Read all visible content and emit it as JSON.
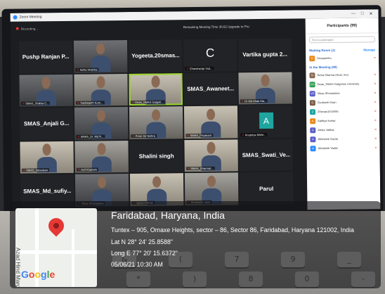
{
  "zoom": {
    "window_title": "Zoom Meeting",
    "recording_label": "Recording...",
    "banner": "Remaining Meeting Time 36:52 Upgrade to Pro",
    "window_controls": [
      "—",
      "□",
      "✕"
    ],
    "tiles": [
      {
        "kind": "name",
        "big": "Pushp Ranjan P...",
        "label": ""
      },
      {
        "kind": "cam",
        "big": "",
        "label": "Neha Sharma"
      },
      {
        "kind": "name",
        "big": "Yogeeta.20smas...",
        "label": ""
      },
      {
        "kind": "letter",
        "big": "C",
        "label": "Chandravija Yad..."
      },
      {
        "kind": "name",
        "big": "Vartika gupta 2...",
        "label": ""
      },
      {
        "kind": "cam",
        "big": "",
        "label": "SMAS_Shikha C..."
      },
      {
        "kind": "cam2",
        "big": "",
        "label": "Yashwanth Kum..."
      },
      {
        "kind": "cam3",
        "big": "",
        "label": "Dean_SMAS Galgoti...",
        "speaking": true
      },
      {
        "kind": "name",
        "big": "SMAS_Awaneet...",
        "label": ""
      },
      {
        "kind": "cam2",
        "big": "",
        "label": "Dr Md Aftab Ala..."
      },
      {
        "kind": "name",
        "big": "SMAS_Anjali G...",
        "label": ""
      },
      {
        "kind": "cam",
        "big": "",
        "label": "SMAS_Dr. Md N..."
      },
      {
        "kind": "cam2",
        "big": "",
        "label": "Prem Sri Nishra"
      },
      {
        "kind": "cam3",
        "big": "",
        "label": "SMAS_Priyakant"
      },
      {
        "kind": "avatar",
        "big": "A",
        "label": "Anupriya Mishr..."
      },
      {
        "kind": "cam3",
        "big": "",
        "label": "SMAS_Vatsalyan"
      },
      {
        "kind": "cam2",
        "big": "",
        "label": "Asif Khanam"
      },
      {
        "kind": "name",
        "big": "Shalini singh",
        "label": ""
      },
      {
        "kind": "cam3",
        "big": "",
        "label": "SMAS_Dharmat..."
      },
      {
        "kind": "name",
        "big": "SMAS_Swati_Ve...",
        "label": ""
      },
      {
        "kind": "name",
        "big": "SMAS_Md_sufiy...",
        "label": ""
      },
      {
        "kind": "cam",
        "big": "",
        "label": "Vikas Shrivastava"
      },
      {
        "kind": "cam3",
        "big": "",
        "label": "Ujjwal Pathak"
      },
      {
        "kind": "cam2",
        "big": "",
        "label": "Shashank Jana"
      },
      {
        "kind": "name",
        "big": "Parul",
        "label": ""
      }
    ],
    "participants": {
      "header": "Participants (99)",
      "search_placeholder": "Find a participant",
      "waiting_label": "Waiting Room (1)",
      "manage_label": "Manage",
      "waiting": [
        {
          "initial": "D",
          "name": "Deepanshu",
          "color": "#e8891c"
        }
      ],
      "in_meeting_label": "In the Meeting (99)",
      "list": [
        {
          "initial": "N",
          "name": "Neha Sharma (Host, me)",
          "color": "#8a6a55"
        },
        {
          "initial": "DG",
          "name": "Dean_SMAS Galgotias University",
          "color": "#2e9e4f"
        },
        {
          "initial": "VS",
          "name": "Vikas Shrivastava",
          "color": "#5b5fc7"
        },
        {
          "initial": "G",
          "name": "Grutheeli Khan",
          "color": "#7a5c46"
        },
        {
          "initial": "2",
          "name": "20smas1010006",
          "color": "#1fa5a0"
        },
        {
          "initial": "A",
          "name": "Aaditya kumar",
          "color": "#e8891c"
        },
        {
          "initial": "A",
          "name": "Abdul Jabbar",
          "color": "#5b5fc7"
        },
        {
          "initial": "A",
          "name": "Abhishek Gupta",
          "color": "#5b5fc7"
        },
        {
          "initial": "A",
          "name": "Abhishek Yadav",
          "color": "#2d8cff"
        }
      ]
    }
  },
  "geotag": {
    "city": "Faridabad, Haryana, India",
    "address": "Tuntex – 905, Omaxe Heights, sector – 86, Sector 86, Faridabad, Haryana 121002, India",
    "lat": "Lat N 28° 24' 25.8588\"",
    "long": "Long E 77° 20' 15.6372\"",
    "datetime": "05/06/21 10:30 AM",
    "map_road": "Azad Hind Marg",
    "map_brand": "Google",
    "brand_colors": [
      "#4285f4",
      "#ea4335",
      "#fbbc05",
      "#4285f4",
      "#34a853",
      "#ea4335"
    ]
  },
  "keyboard": {
    "keys": [
      "&",
      "*",
      "(",
      ")",
      "7",
      "8",
      "9",
      "0",
      "_",
      "-"
    ]
  }
}
